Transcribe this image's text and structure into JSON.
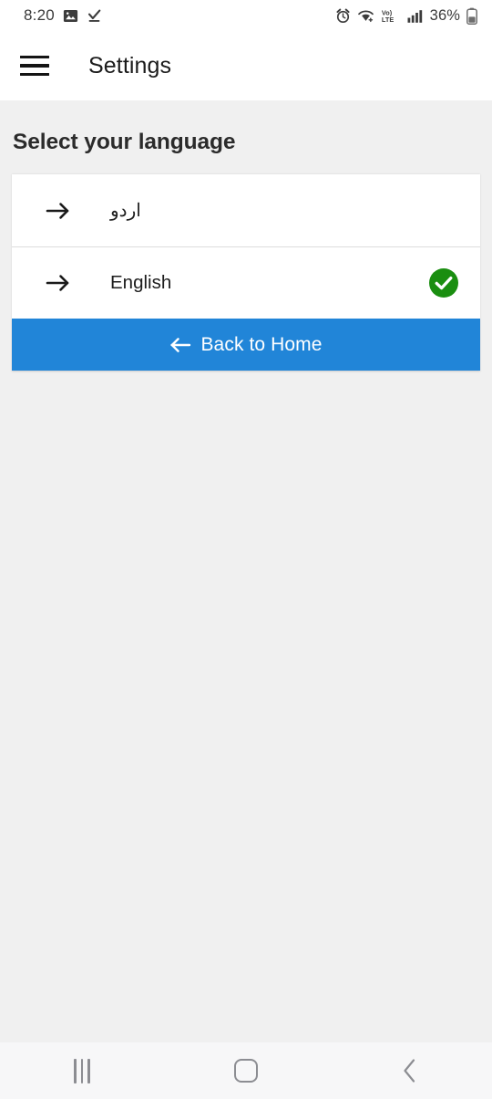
{
  "status_bar": {
    "time": "8:20",
    "battery_percent": "36%",
    "left_icons": [
      "photo-icon",
      "download-complete-icon"
    ],
    "right_icons": [
      "alarm-icon",
      "wifi-icon",
      "volte-icon",
      "signal-bars-icon",
      "battery-icon"
    ],
    "volte_label_top": "Vo)",
    "volte_label_bottom": "LTE"
  },
  "app_bar": {
    "menu_icon": "hamburger-menu-icon",
    "title": "Settings"
  },
  "main": {
    "heading": "Select your language",
    "languages": [
      {
        "label": "اردو",
        "rtl": true,
        "selected": false,
        "arrow_icon": "arrow-right-icon"
      },
      {
        "label": "English",
        "rtl": false,
        "selected": true,
        "arrow_icon": "arrow-right-icon",
        "check_icon": "check-circle-icon"
      }
    ],
    "back_button": {
      "label": "Back to Home",
      "arrow_icon": "arrow-left-icon"
    }
  },
  "nav_bar": {
    "recents": "recents-icon",
    "home": "home-icon",
    "back": "back-icon"
  },
  "colors": {
    "accent_blue": "#2185d8",
    "selected_green": "#1a8e10",
    "page_background": "#f0f0f0",
    "surface": "#ffffff"
  }
}
